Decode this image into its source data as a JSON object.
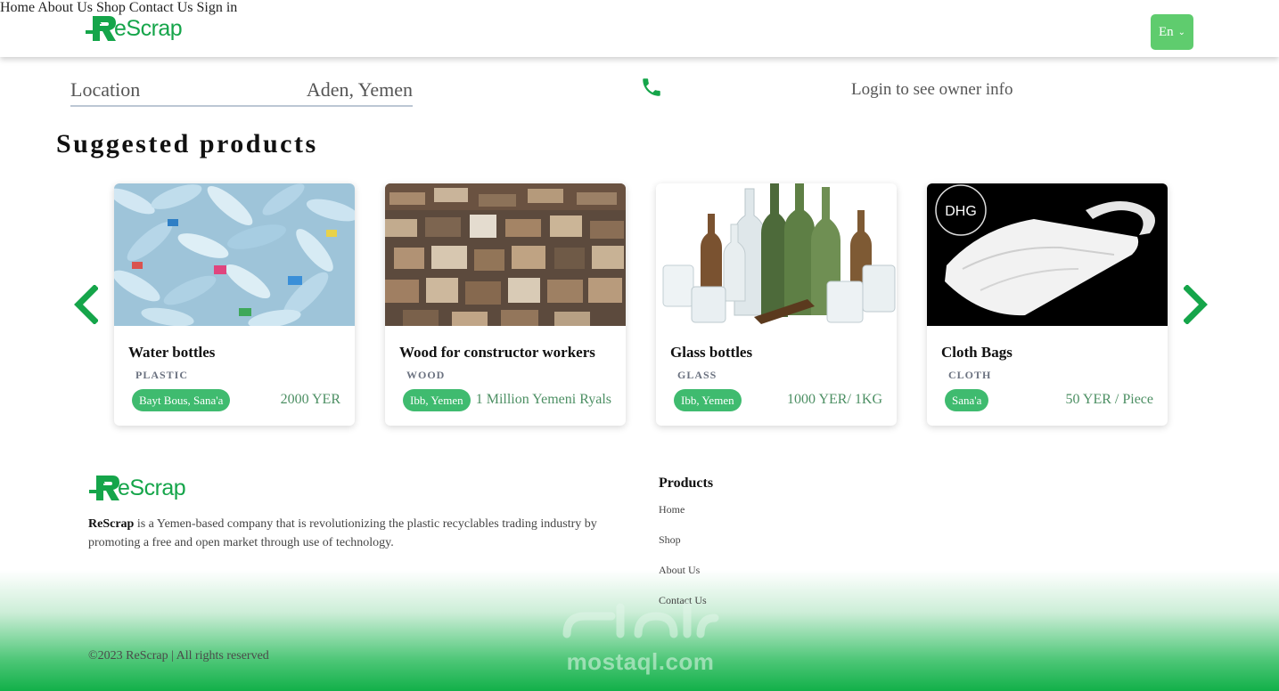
{
  "header": {
    "brand": "eScrap",
    "nav": [
      "Home",
      "About Us",
      "Shop",
      "Contact Us"
    ],
    "sign_in": "Sign in",
    "language": "En"
  },
  "info": {
    "location_label": "Location",
    "location_value": "Aden, Yemen",
    "owner_prompt": "Login to see owner info"
  },
  "suggested": {
    "title": "Suggested products",
    "products": [
      {
        "name": "Water bottles",
        "category": "PLASTIC",
        "location": "Bayt Bous, Sana'a",
        "price": "2000 YER"
      },
      {
        "name": "Wood for constructor workers",
        "category": "WOOD",
        "location": "Ibb, Yemen",
        "price": "1 Million Yemeni Ryals"
      },
      {
        "name": "Glass bottles",
        "category": "GLASS",
        "location": "Ibb, Yemen",
        "price": "1000 YER/ 1KG"
      },
      {
        "name": "Cloth Bags",
        "category": "CLOTH",
        "location": "Sana'a",
        "price": "50 YER / Piece"
      }
    ],
    "bag_brand": "DHG"
  },
  "footer": {
    "brand": "eScrap",
    "company": "ReScrap",
    "description": " is a Yemen-based company that is revolutionizing the plastic recyclables trading industry by promoting a free and open market through use of technology.",
    "products_heading": "Products",
    "links": [
      "Home",
      "Shop",
      "About Us",
      "Contact Us"
    ],
    "copyright": "©2023 ReScrap | All rights reserved"
  },
  "watermark": {
    "latin": "mostaql.com"
  },
  "colors": {
    "brand_green": "#15a54a",
    "badge_green": "#3fbb6f",
    "lang_button": "#5fcc6e"
  },
  "icons": [
    "rescrap-logo-icon",
    "phone-icon",
    "chevron-left-icon",
    "chevron-right-icon",
    "chevron-down-icon"
  ]
}
